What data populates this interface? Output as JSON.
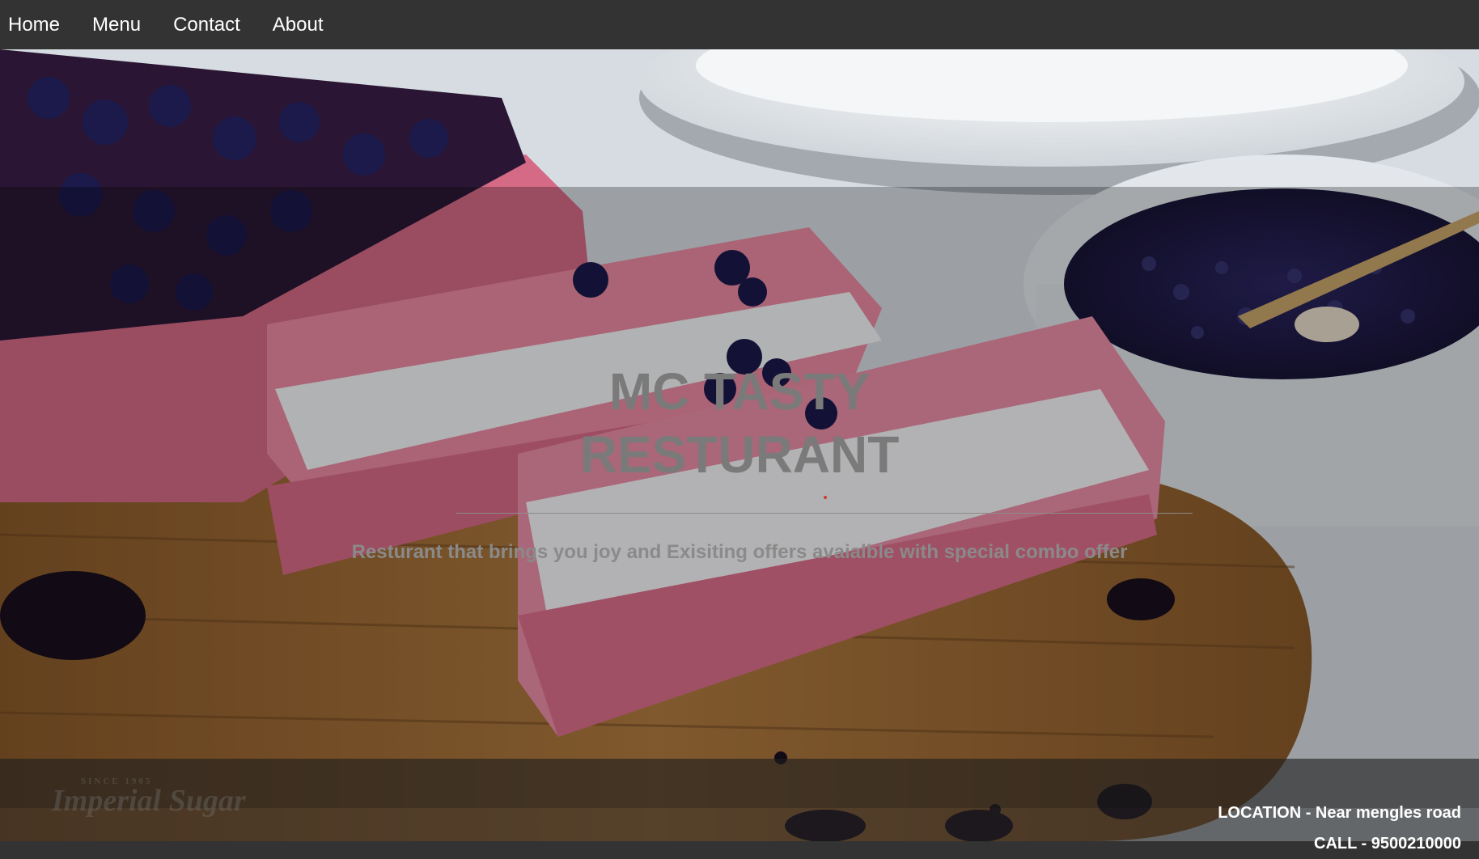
{
  "nav": {
    "items": [
      {
        "label": "Home"
      },
      {
        "label": "Menu"
      },
      {
        "label": "Contact"
      },
      {
        "label": "About"
      }
    ]
  },
  "hero": {
    "title_line1": "MC TASTY",
    "title_line2": "RESTURANT",
    "subtitle": "Resturant that brings you joy and Exisiting offers avaialble with special combo offer"
  },
  "footer": {
    "logo_small": "SINCE 1905",
    "logo_text": "Imperial Sugar",
    "location": "LOCATION - Near mengles road",
    "call": "CALL - 9500210000"
  },
  "colors": {
    "nav_background": "#333333",
    "nav_text": "#ffffff",
    "title_text": "#7a7a7a"
  }
}
